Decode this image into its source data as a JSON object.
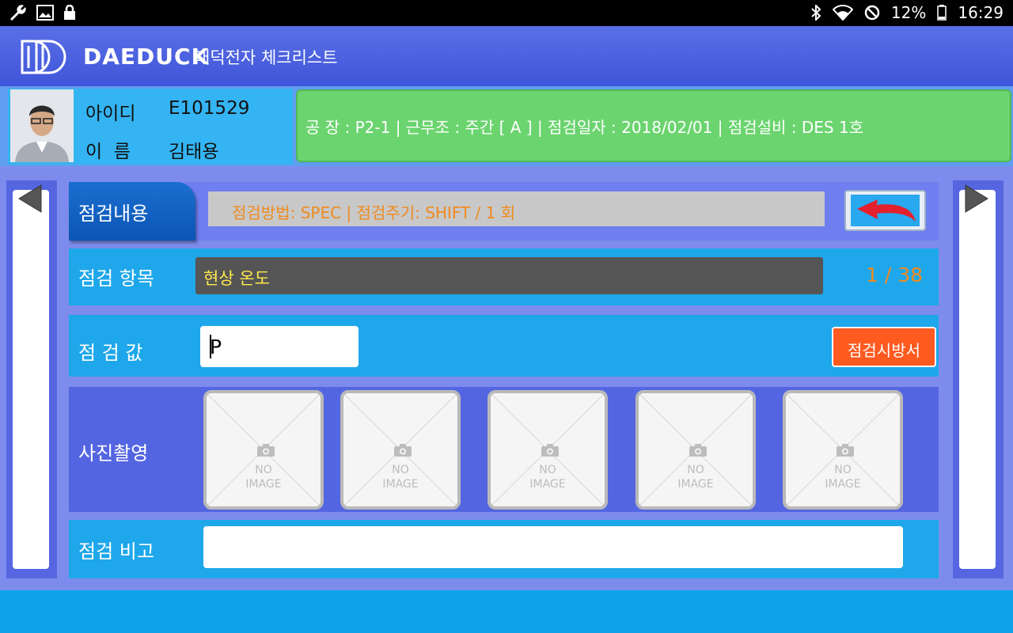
{
  "status_bar": {
    "battery": "12%",
    "time": "16:29",
    "left_icons": [
      "wrench-icon",
      "image-icon",
      "lock-icon"
    ],
    "right_icons": [
      "bluetooth-icon",
      "wifi-icon",
      "do-not-disturb-icon",
      "battery-icon"
    ]
  },
  "header": {
    "brand": "DAEDUCK",
    "title": "대덕전자 체크리스트"
  },
  "user": {
    "id_label": "아이디",
    "id_value": "E101529",
    "name_label": "이  름",
    "name_value": "김태용"
  },
  "info": {
    "text": "공 장 : P2-1 |  근무조 : 주간 [ A ]   |  점검일자 : 2018/02/01 |  점검설비 : DES 1호"
  },
  "inspection": {
    "tab_label": "점검내용",
    "method_text": "점검방법: SPEC | 점검주기: SHIFT / 1 회",
    "item_label": "점검 항목",
    "item_value": "현상 온도",
    "counter": "1 / 38",
    "value_label": "점 검 값",
    "value_input": "P",
    "spec_button": "점검시방서",
    "photo_label": "사진촬영",
    "photos": [
      {
        "line1": "NO",
        "line2": "IMAGE"
      },
      {
        "line1": "NO",
        "line2": "IMAGE"
      },
      {
        "line1": "NO",
        "line2": "IMAGE"
      },
      {
        "line1": "NO",
        "line2": "IMAGE"
      },
      {
        "line1": "NO",
        "line2": "IMAGE"
      }
    ],
    "remark_label": "점검 비고",
    "remark_value": ""
  },
  "colors": {
    "header": "#3f55d9",
    "info_box": "#6bd46f",
    "row_blue": "#1ea7ea",
    "counter": "#f0891f",
    "spec_button": "#ff5a1f"
  }
}
